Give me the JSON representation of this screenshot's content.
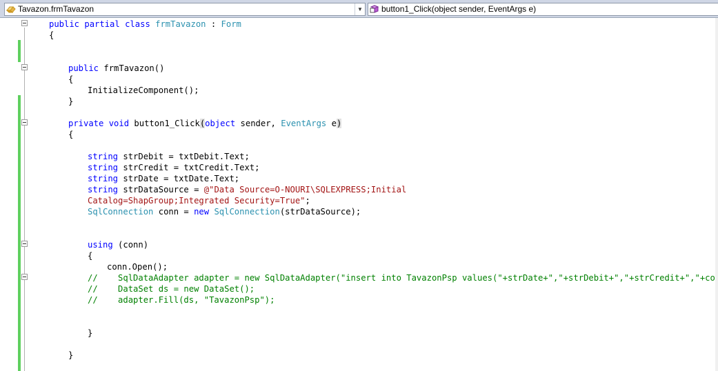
{
  "navbar": {
    "type_selector": "Tavazon.frmTavazon",
    "member_selector": "button1_Click(object sender, EventArgs e)"
  },
  "code": {
    "l1_kw1": "public",
    "l1_kw2": "partial",
    "l1_kw3": "class",
    "l1_ty1": "frmTavazon",
    "l1_sep": " : ",
    "l1_ty2": "Form",
    "brace_open": "{",
    "brace_close": "}",
    "l5_kw": "public",
    "l5_rest": " frmTavazon()",
    "l7_text": "InitializeComponent();",
    "l10_kw1": "private",
    "l10_kw2": "void",
    "l10_name": " button1_Click",
    "l10_paren_open": "(",
    "l10_kw3": "object",
    "l10_mid": " sender, ",
    "l10_ty": "EventArgs",
    "l10_e": " e",
    "l10_paren_close": ")",
    "kw_string": "string",
    "l13_rest": " strDebit = txtDebit.Text;",
    "l14_rest": " strCredit = txtCredit.Text;",
    "l15_rest": " strDate = txtDate.Text;",
    "l16_rest": " strDataSource = ",
    "l16_str": "@\"Data Source=O-NOURI\\SQLEXPRESS;Initial",
    "l17_str": "Catalog=ShapGroup;Integrated Security=True\"",
    "l17_end": ";",
    "ty_sqlconnection": "SqlConnection",
    "l18_mid": " conn = ",
    "kw_new": "new",
    "l18_space": " ",
    "l18_end": "(strDataSource);",
    "kw_using": "using",
    "l21_rest": " (conn)",
    "l23_text": "conn.Open();",
    "l24_comment": "//    SqlDataAdapter adapter = new SqlDataAdapter(\"insert into TavazonPsp values(\"+strDate+\",\"+strDebit+\",\"+strCredit+\",\"+comboPsp.",
    "l25_comment": "//    DataSet ds = new DataSet();",
    "l26_comment": "//    adapter.Fill(ds, \"TavazonPsp\");"
  }
}
